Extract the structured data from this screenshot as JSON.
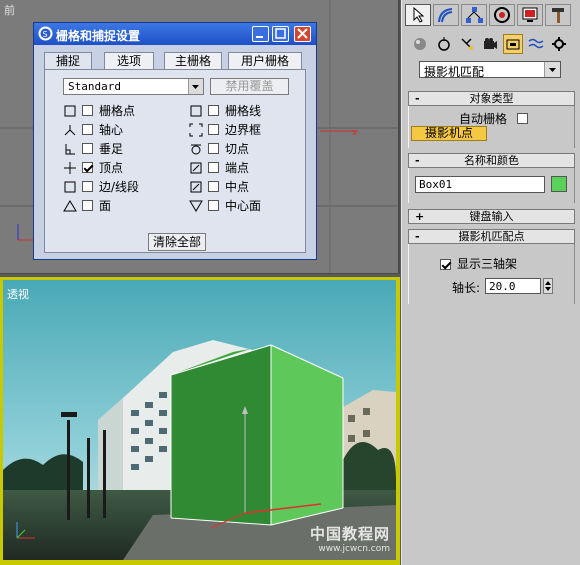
{
  "viewports": {
    "front_label": "前",
    "persp_label": "透视"
  },
  "dialog": {
    "title": "栅格和捕捉设置",
    "tabs": [
      "捕捉",
      "选项",
      "主栅格",
      "用户栅格"
    ],
    "dropdown_value": "Standard",
    "disable_override_label": "禁用覆盖",
    "snap_left": [
      {
        "label": "栅格点",
        "checked": false,
        "icon": "grid-point-icon"
      },
      {
        "label": "轴心",
        "checked": false,
        "icon": "pivot-icon"
      },
      {
        "label": "垂足",
        "checked": false,
        "icon": "perpendicular-icon"
      },
      {
        "label": "顶点",
        "checked": true,
        "icon": "vertex-icon"
      },
      {
        "label": "边/线段",
        "checked": false,
        "icon": "edge-icon"
      },
      {
        "label": "面",
        "checked": false,
        "icon": "face-icon"
      }
    ],
    "snap_right": [
      {
        "label": "栅格线",
        "checked": false,
        "icon": "grid-line-icon"
      },
      {
        "label": "边界框",
        "checked": false,
        "icon": "bounding-box-icon"
      },
      {
        "label": "切点",
        "checked": false,
        "icon": "tangent-icon"
      },
      {
        "label": "端点",
        "checked": false,
        "icon": "endpoint-icon"
      },
      {
        "label": "中点",
        "checked": false,
        "icon": "midpoint-icon"
      },
      {
        "label": "中心面",
        "checked": false,
        "icon": "center-face-icon"
      }
    ],
    "clear_all_label": "清除全部"
  },
  "panel": {
    "dropdown_value": "摄影机匹配",
    "rollout_object_type": "对象类型",
    "auto_grid_label": "自动栅格",
    "camera_point_label": "摄影机点",
    "rollout_name_color": "名称和颜色",
    "object_name": "Box01",
    "object_color": "#5ad15a",
    "rollout_keyboard": "键盘输入",
    "rollout_camera_match_point": "摄影机匹配点",
    "show_axis_label": "显示三轴架",
    "show_axis_checked": true,
    "axis_length_label": "轴长:",
    "axis_length_value": "20.0",
    "expand_sign": "+",
    "collapse_sign": "-"
  },
  "watermark": {
    "main": "中国教程网",
    "sub": "www.jcwcn.com"
  }
}
